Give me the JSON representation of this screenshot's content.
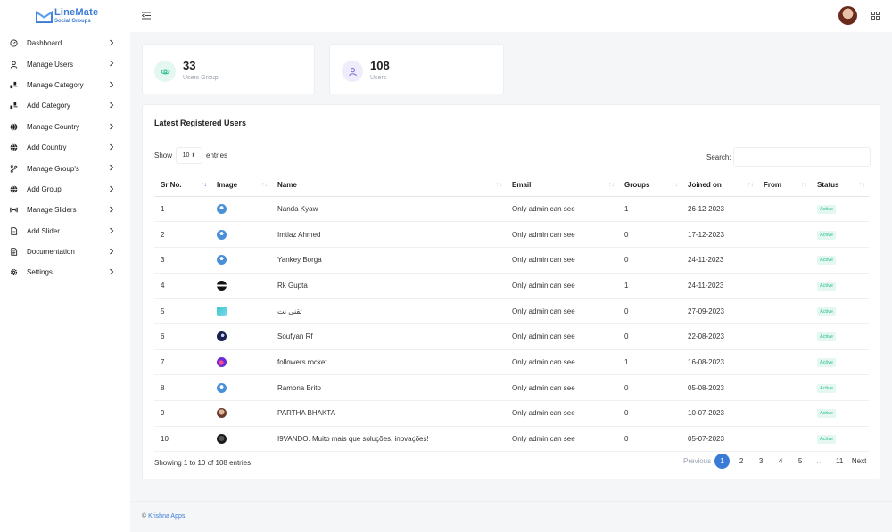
{
  "brand": {
    "name": "LineMate",
    "subtitle": "Social Groups"
  },
  "sidebar": {
    "items": [
      {
        "label": "Dashboard",
        "icon": "dashboard-icon"
      },
      {
        "label": "Manage Users",
        "icon": "user-icon"
      },
      {
        "label": "Manage Category",
        "icon": "category-icon"
      },
      {
        "label": "Add Category",
        "icon": "category-icon"
      },
      {
        "label": "Manage Country",
        "icon": "globe-icon"
      },
      {
        "label": "Add Country",
        "icon": "globe-icon"
      },
      {
        "label": "Manage Group's",
        "icon": "branch-icon"
      },
      {
        "label": "Add Group",
        "icon": "globe-icon"
      },
      {
        "label": "Manage Sliders",
        "icon": "sliders-icon"
      },
      {
        "label": "Add Slider",
        "icon": "file-icon"
      },
      {
        "label": "Documentation",
        "icon": "document-icon"
      },
      {
        "label": "Settings",
        "icon": "gear-icon"
      }
    ]
  },
  "stats": [
    {
      "value": "33",
      "label": "Users Group",
      "icon": "eye-icon",
      "color": "#2bbf92",
      "bg": "#e4f7f1"
    },
    {
      "value": "108",
      "label": "Users",
      "icon": "user-icon",
      "color": "#7a6fd8",
      "bg": "#efedfb"
    }
  ],
  "table": {
    "title": "Latest Registered Users",
    "show_label": "Show",
    "entries_value": "10",
    "entries_label": "entries",
    "search_label": "Search:",
    "columns": [
      "Sr No.",
      "Image",
      "Name",
      "Email",
      "Groups",
      "Joined on",
      "From",
      "Status"
    ],
    "rows": [
      {
        "sr": "1",
        "name": "Nanda Kyaw",
        "email": "Only admin can see",
        "groups": "1",
        "joined": "26-12-2023",
        "from": "",
        "status": "Active",
        "img": "default-avatar"
      },
      {
        "sr": "2",
        "name": "Imtiaz Ahmed",
        "email": "Only admin can see",
        "groups": "0",
        "joined": "17-12-2023",
        "from": "",
        "status": "Active",
        "img": "default-avatar"
      },
      {
        "sr": "3",
        "name": "Yankey Borga",
        "email": "Only admin can see",
        "groups": "0",
        "joined": "24-11-2023",
        "from": "",
        "status": "Active",
        "img": "default-avatar"
      },
      {
        "sr": "4",
        "name": "Rk Gupta",
        "email": "Only admin can see",
        "groups": "1",
        "joined": "24-11-2023",
        "from": "",
        "status": "Active",
        "img": "dark-avatar"
      },
      {
        "sr": "5",
        "name": "تقني نت",
        "email": "Only admin can see",
        "groups": "0",
        "joined": "27-09-2023",
        "from": "",
        "status": "Active",
        "img": "logo-avatar"
      },
      {
        "sr": "6",
        "name": "Soufyan Rf",
        "email": "Only admin can see",
        "groups": "0",
        "joined": "22-08-2023",
        "from": "",
        "status": "Active",
        "img": "night-avatar"
      },
      {
        "sr": "7",
        "name": "followers rocket",
        "email": "Only admin can see",
        "groups": "1",
        "joined": "16-08-2023",
        "from": "",
        "status": "Active",
        "img": "rocket-avatar"
      },
      {
        "sr": "8",
        "name": "Ramona Brito",
        "email": "Only admin can see",
        "groups": "0",
        "joined": "05-08-2023",
        "from": "",
        "status": "Active",
        "img": "default-avatar"
      },
      {
        "sr": "9",
        "name": "PARTHA BHAKTA",
        "email": "Only admin can see",
        "groups": "0",
        "joined": "10-07-2023",
        "from": "",
        "status": "Active",
        "img": "photo-avatar"
      },
      {
        "sr": "10",
        "name": "I9VANDO. Muito mais que soluções, inovações!",
        "email": "Only admin can see",
        "groups": "0",
        "joined": "05-07-2023",
        "from": "",
        "status": "Active",
        "img": "photo-dark-avatar"
      }
    ],
    "showing": "Showing 1 to 10 of 108 entries",
    "pagination": [
      "Previous",
      "1",
      "2",
      "3",
      "4",
      "5",
      "…",
      "11",
      "Next"
    ]
  },
  "footer": {
    "copyright": "©",
    "company": "Krishna Apps"
  },
  "colors": {
    "accent": "#3a7bd5",
    "active_badge_bg": "#e4f7f1",
    "active_badge_text": "#2bbf92"
  }
}
